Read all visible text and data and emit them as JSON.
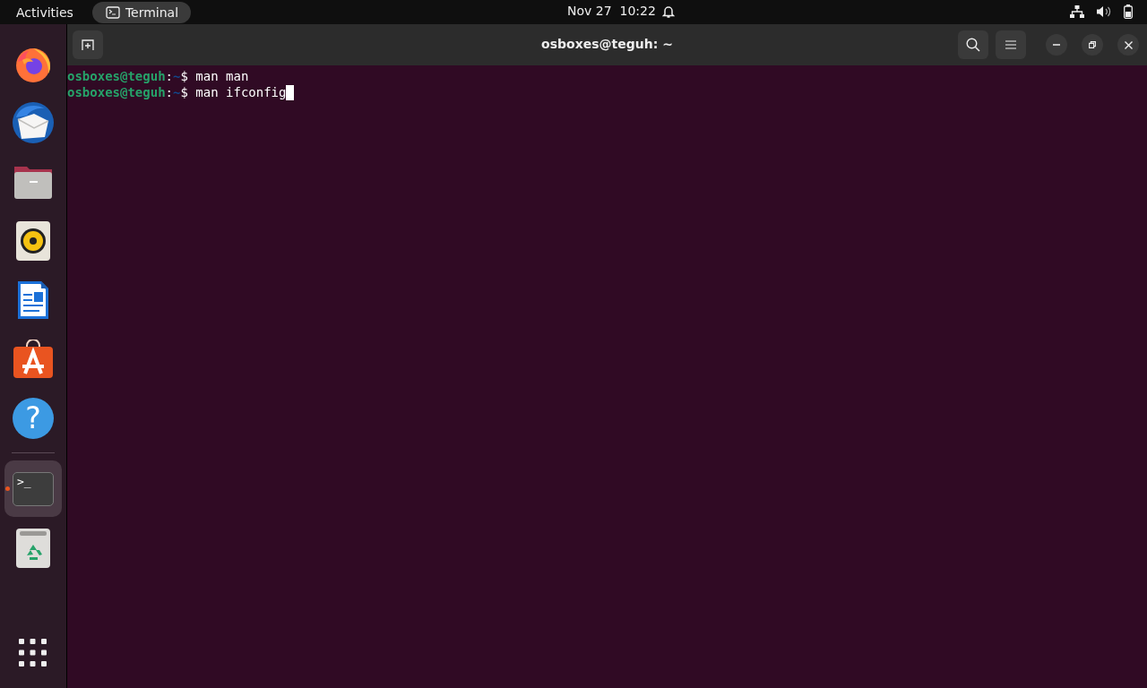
{
  "top_bar": {
    "activities": "Activities",
    "app_menu": {
      "label": "Terminal"
    },
    "clock": "Nov 27  10:22"
  },
  "dock": {
    "items": [
      {
        "kind": "firefox",
        "running": false
      },
      {
        "kind": "thunderbird",
        "running": false
      },
      {
        "kind": "files",
        "running": false
      },
      {
        "kind": "rhythmbox",
        "running": false
      },
      {
        "kind": "writer",
        "running": false
      },
      {
        "kind": "store",
        "running": false
      },
      {
        "kind": "help",
        "glyph": "?",
        "running": false
      },
      {
        "kind": "separator"
      },
      {
        "kind": "terminal",
        "glyph": ">_",
        "running": true,
        "selected": true
      },
      {
        "kind": "trash",
        "running": false
      }
    ]
  },
  "window": {
    "title": "osboxes@teguh: ~",
    "lines": [
      {
        "user": "osboxes@teguh",
        "sep": ":",
        "path": "~",
        "prompt": "$",
        "command": "man man",
        "cursor": false
      },
      {
        "user": "osboxes@teguh",
        "sep": ":",
        "path": "~",
        "prompt": "$",
        "command": "man ifconfig",
        "cursor": true
      }
    ]
  }
}
